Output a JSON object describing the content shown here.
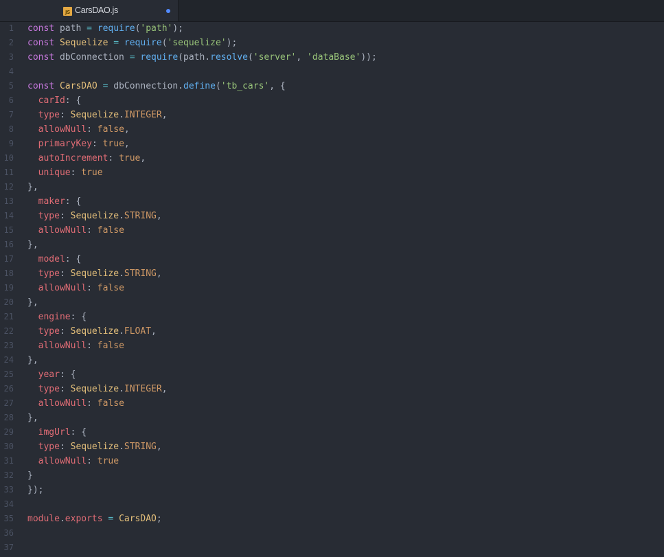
{
  "tab": {
    "icon_label": "JS",
    "filename": "CarsDAO.js"
  },
  "colors": {
    "background": "#282c34",
    "keyword": "#c678dd",
    "function": "#61afef",
    "string": "#98c379",
    "class": "#e5c07b",
    "property": "#e06c75",
    "constant": "#d19a66",
    "operator": "#56b6c2",
    "text": "#abb2bf",
    "modified_dot": "#528bff"
  },
  "lines": [
    {
      "n": "1",
      "tokens": [
        [
          "kw",
          "const"
        ],
        [
          "txt",
          " path "
        ],
        [
          "op",
          "="
        ],
        [
          "txt",
          " "
        ],
        [
          "fn",
          "require"
        ],
        [
          "txt",
          "("
        ],
        [
          "str",
          "'path'"
        ],
        [
          "txt",
          ");"
        ]
      ]
    },
    {
      "n": "2",
      "tokens": [
        [
          "kw",
          "const"
        ],
        [
          "txt",
          " "
        ],
        [
          "cls",
          "Sequelize"
        ],
        [
          "txt",
          " "
        ],
        [
          "op",
          "="
        ],
        [
          "txt",
          " "
        ],
        [
          "fn",
          "require"
        ],
        [
          "txt",
          "("
        ],
        [
          "str",
          "'sequelize'"
        ],
        [
          "txt",
          ");"
        ]
      ]
    },
    {
      "n": "3",
      "tokens": [
        [
          "kw",
          "const"
        ],
        [
          "txt",
          " dbConnection "
        ],
        [
          "op",
          "="
        ],
        [
          "txt",
          " "
        ],
        [
          "fn",
          "require"
        ],
        [
          "txt",
          "(path."
        ],
        [
          "fn",
          "resolve"
        ],
        [
          "txt",
          "("
        ],
        [
          "str",
          "'server'"
        ],
        [
          "txt",
          ", "
        ],
        [
          "str",
          "'dataBase'"
        ],
        [
          "txt",
          "));"
        ]
      ]
    },
    {
      "n": "4",
      "tokens": []
    },
    {
      "n": "5",
      "tokens": [
        [
          "kw",
          "const"
        ],
        [
          "txt",
          " "
        ],
        [
          "cls",
          "CarsDAO"
        ],
        [
          "txt",
          " "
        ],
        [
          "op",
          "="
        ],
        [
          "txt",
          " dbConnection."
        ],
        [
          "fn",
          "define"
        ],
        [
          "txt",
          "("
        ],
        [
          "str",
          "'tb_cars'"
        ],
        [
          "txt",
          ", {"
        ]
      ]
    },
    {
      "n": "6",
      "tokens": [
        [
          "txt",
          "  "
        ],
        [
          "prop",
          "carId"
        ],
        [
          "txt",
          ": {"
        ]
      ]
    },
    {
      "n": "7",
      "tokens": [
        [
          "txt",
          "  "
        ],
        [
          "prop",
          "type"
        ],
        [
          "txt",
          ": "
        ],
        [
          "cls",
          "Sequelize"
        ],
        [
          "txt",
          "."
        ],
        [
          "num",
          "INTEGER"
        ],
        [
          "txt",
          ","
        ]
      ]
    },
    {
      "n": "8",
      "tokens": [
        [
          "txt",
          "  "
        ],
        [
          "prop",
          "allowNull"
        ],
        [
          "txt",
          ": "
        ],
        [
          "num",
          "false"
        ],
        [
          "txt",
          ","
        ]
      ]
    },
    {
      "n": "9",
      "tokens": [
        [
          "txt",
          "  "
        ],
        [
          "prop",
          "primaryKey"
        ],
        [
          "txt",
          ": "
        ],
        [
          "num",
          "true"
        ],
        [
          "txt",
          ","
        ]
      ]
    },
    {
      "n": "10",
      "tokens": [
        [
          "txt",
          "  "
        ],
        [
          "prop",
          "autoIncrement"
        ],
        [
          "txt",
          ": "
        ],
        [
          "num",
          "true"
        ],
        [
          "txt",
          ","
        ]
      ]
    },
    {
      "n": "11",
      "tokens": [
        [
          "txt",
          "  "
        ],
        [
          "prop",
          "unique"
        ],
        [
          "txt",
          ": "
        ],
        [
          "num",
          "true"
        ]
      ]
    },
    {
      "n": "12",
      "tokens": [
        [
          "txt",
          "},"
        ]
      ]
    },
    {
      "n": "13",
      "tokens": [
        [
          "txt",
          "  "
        ],
        [
          "prop",
          "maker"
        ],
        [
          "txt",
          ": {"
        ]
      ]
    },
    {
      "n": "14",
      "tokens": [
        [
          "txt",
          "  "
        ],
        [
          "prop",
          "type"
        ],
        [
          "txt",
          ": "
        ],
        [
          "cls",
          "Sequelize"
        ],
        [
          "txt",
          "."
        ],
        [
          "num",
          "STRING"
        ],
        [
          "txt",
          ","
        ]
      ]
    },
    {
      "n": "15",
      "tokens": [
        [
          "txt",
          "  "
        ],
        [
          "prop",
          "allowNull"
        ],
        [
          "txt",
          ": "
        ],
        [
          "num",
          "false"
        ]
      ]
    },
    {
      "n": "16",
      "tokens": [
        [
          "txt",
          "},"
        ]
      ]
    },
    {
      "n": "17",
      "tokens": [
        [
          "txt",
          "  "
        ],
        [
          "prop",
          "model"
        ],
        [
          "txt",
          ": {"
        ]
      ]
    },
    {
      "n": "18",
      "tokens": [
        [
          "txt",
          "  "
        ],
        [
          "prop",
          "type"
        ],
        [
          "txt",
          ": "
        ],
        [
          "cls",
          "Sequelize"
        ],
        [
          "txt",
          "."
        ],
        [
          "num",
          "STRING"
        ],
        [
          "txt",
          ","
        ]
      ]
    },
    {
      "n": "19",
      "tokens": [
        [
          "txt",
          "  "
        ],
        [
          "prop",
          "allowNull"
        ],
        [
          "txt",
          ": "
        ],
        [
          "num",
          "false"
        ]
      ]
    },
    {
      "n": "20",
      "tokens": [
        [
          "txt",
          "},"
        ]
      ]
    },
    {
      "n": "21",
      "tokens": [
        [
          "txt",
          "  "
        ],
        [
          "prop",
          "engine"
        ],
        [
          "txt",
          ": {"
        ]
      ]
    },
    {
      "n": "22",
      "tokens": [
        [
          "txt",
          "  "
        ],
        [
          "prop",
          "type"
        ],
        [
          "txt",
          ": "
        ],
        [
          "cls",
          "Sequelize"
        ],
        [
          "txt",
          "."
        ],
        [
          "num",
          "FLOAT"
        ],
        [
          "txt",
          ","
        ]
      ]
    },
    {
      "n": "23",
      "tokens": [
        [
          "txt",
          "  "
        ],
        [
          "prop",
          "allowNull"
        ],
        [
          "txt",
          ": "
        ],
        [
          "num",
          "false"
        ]
      ]
    },
    {
      "n": "24",
      "tokens": [
        [
          "txt",
          "},"
        ]
      ]
    },
    {
      "n": "25",
      "tokens": [
        [
          "txt",
          "  "
        ],
        [
          "prop",
          "year"
        ],
        [
          "txt",
          ": {"
        ]
      ]
    },
    {
      "n": "26",
      "tokens": [
        [
          "txt",
          "  "
        ],
        [
          "prop",
          "type"
        ],
        [
          "txt",
          ": "
        ],
        [
          "cls",
          "Sequelize"
        ],
        [
          "txt",
          "."
        ],
        [
          "num",
          "INTEGER"
        ],
        [
          "txt",
          ","
        ]
      ]
    },
    {
      "n": "27",
      "tokens": [
        [
          "txt",
          "  "
        ],
        [
          "prop",
          "allowNull"
        ],
        [
          "txt",
          ": "
        ],
        [
          "num",
          "false"
        ]
      ]
    },
    {
      "n": "28",
      "tokens": [
        [
          "txt",
          "},"
        ]
      ]
    },
    {
      "n": "29",
      "tokens": [
        [
          "txt",
          "  "
        ],
        [
          "prop",
          "imgUrl"
        ],
        [
          "txt",
          ": {"
        ]
      ]
    },
    {
      "n": "30",
      "tokens": [
        [
          "txt",
          "  "
        ],
        [
          "prop",
          "type"
        ],
        [
          "txt",
          ": "
        ],
        [
          "cls",
          "Sequelize"
        ],
        [
          "txt",
          "."
        ],
        [
          "num",
          "STRING"
        ],
        [
          "txt",
          ","
        ]
      ]
    },
    {
      "n": "31",
      "tokens": [
        [
          "txt",
          "  "
        ],
        [
          "prop",
          "allowNull"
        ],
        [
          "txt",
          ": "
        ],
        [
          "num",
          "true"
        ]
      ]
    },
    {
      "n": "32",
      "tokens": [
        [
          "txt",
          "}"
        ]
      ]
    },
    {
      "n": "33",
      "tokens": [
        [
          "txt",
          "});"
        ]
      ]
    },
    {
      "n": "34",
      "tokens": []
    },
    {
      "n": "35",
      "tokens": [
        [
          "prop",
          "module"
        ],
        [
          "txt",
          "."
        ],
        [
          "prop",
          "exports"
        ],
        [
          "txt",
          " "
        ],
        [
          "op",
          "="
        ],
        [
          "txt",
          " "
        ],
        [
          "cls",
          "CarsDAO"
        ],
        [
          "txt",
          ";"
        ]
      ]
    },
    {
      "n": "36",
      "tokens": []
    },
    {
      "n": "37",
      "tokens": []
    }
  ]
}
